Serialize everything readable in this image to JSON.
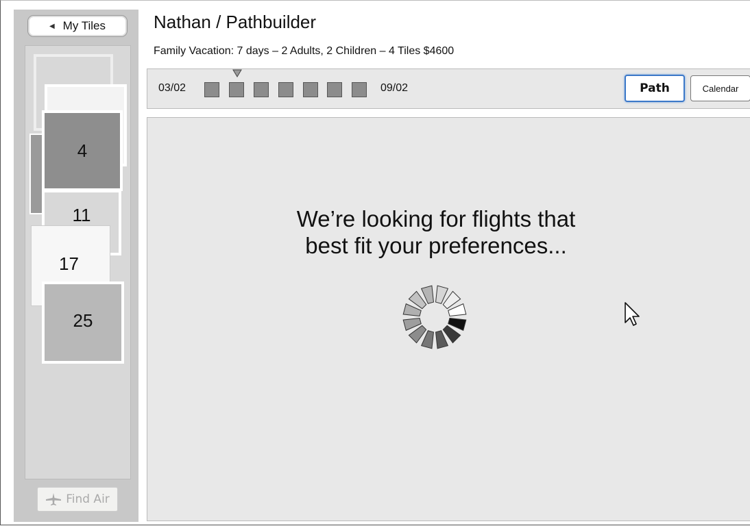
{
  "sidebar": {
    "my_tiles_label": "My Tiles",
    "find_air_label": "Find Air",
    "tiles": [
      {
        "label": "",
        "color": "#d8d8d8"
      },
      {
        "label": "",
        "color": "#f3f3f3"
      },
      {
        "label": "",
        "color": "#9a9a9a"
      },
      {
        "label": "4",
        "color": "#8e8e8e"
      },
      {
        "label": "11",
        "color": "#d8d8d8"
      },
      {
        "label": "17",
        "color": "#f7f7f7"
      },
      {
        "label": "25",
        "color": "#b8b8b8"
      }
    ]
  },
  "header": {
    "title": "Nathan / Pathbuilder",
    "subtitle": "Family Vacation:  7 days – 2 Adults, 2 Children – 4 Tiles $4600"
  },
  "timeline": {
    "start_date": "03/02",
    "end_date": "09/02",
    "days": [
      {
        "color": "#8c8c8c",
        "selected": false
      },
      {
        "color": "#8c8c8c",
        "selected": true
      },
      {
        "color": "#8c8c8c",
        "selected": false
      },
      {
        "color": "#8c8c8c",
        "selected": false
      },
      {
        "color": "#8c8c8c",
        "selected": false
      },
      {
        "color": "#8c8c8c",
        "selected": false
      },
      {
        "color": "#8c8c8c",
        "selected": false
      }
    ],
    "path_label": "Path",
    "calendar_label": "Calendar"
  },
  "main": {
    "message_line1": "We’re looking for flights that",
    "message_line2": "best fit your preferences..."
  },
  "icons": {
    "back": "left-triangle-icon",
    "plane": "plane-icon",
    "spinner": "loading-spinner-icon",
    "cursor": "mouse-pointer-icon",
    "marker": "down-triangle-icon"
  }
}
